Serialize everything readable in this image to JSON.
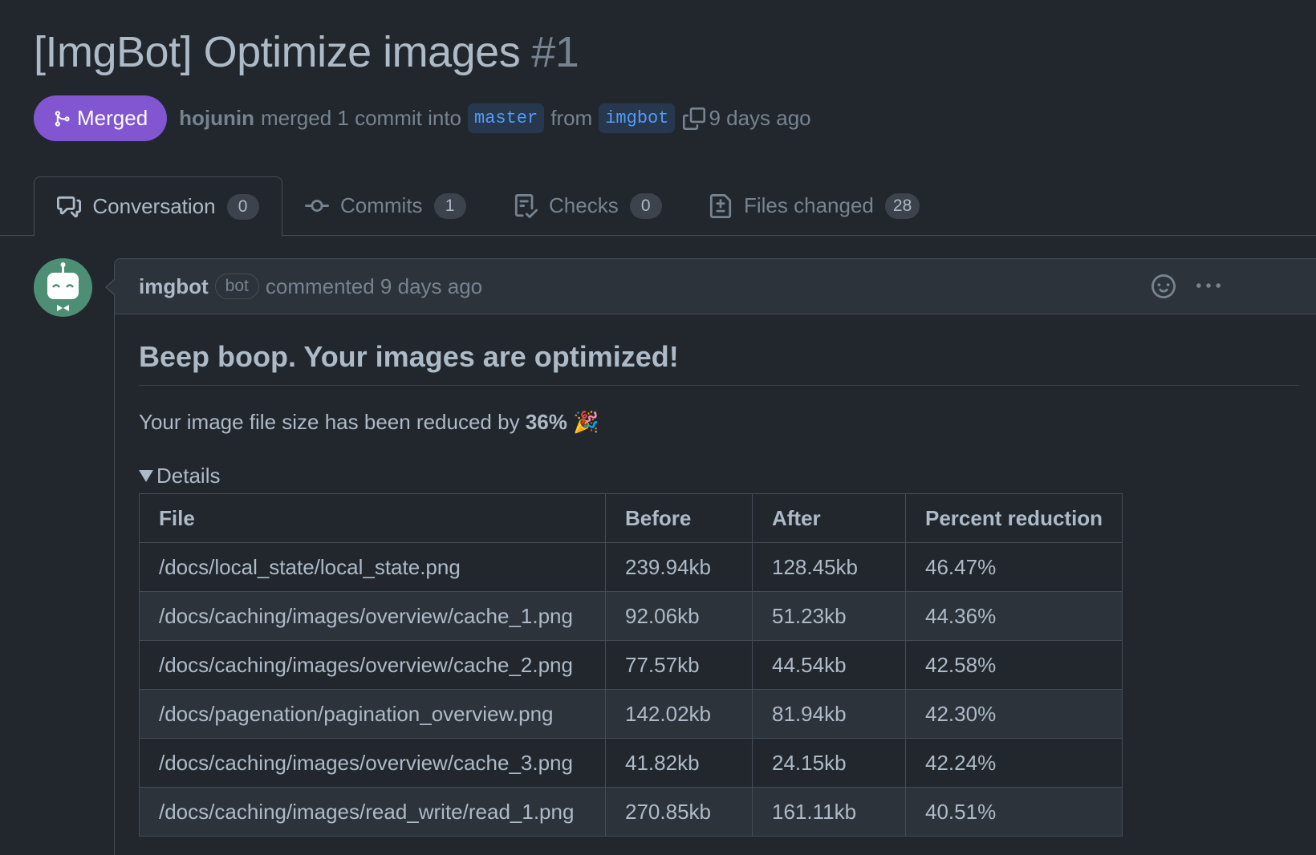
{
  "pr": {
    "title": "[ImgBot] Optimize images",
    "number": "#1",
    "state": "Merged",
    "author": "hojunin",
    "merged_text": "merged 1 commit into",
    "base_branch": "master",
    "from_text": "from",
    "head_branch": "imgbot",
    "time": "9 days ago"
  },
  "tabs": [
    {
      "label": "Conversation",
      "count": "0",
      "icon": "comment-discussion-icon"
    },
    {
      "label": "Commits",
      "count": "1",
      "icon": "git-commit-icon"
    },
    {
      "label": "Checks",
      "count": "0",
      "icon": "checklist-icon"
    },
    {
      "label": "Files changed",
      "count": "28",
      "icon": "file-diff-icon"
    }
  ],
  "comment": {
    "author": "imgbot",
    "badge": "bot",
    "meta": "commented 9 days ago",
    "heading": "Beep boop. Your images are optimized!",
    "summary_prefix": "Your image file size has been reduced by",
    "summary_percent": "36%",
    "summary_emoji": "🎉",
    "details_label": "Details"
  },
  "table": {
    "headers": [
      "File",
      "Before",
      "After",
      "Percent reduction"
    ],
    "rows": [
      [
        "/docs/local_state/local_state.png",
        "239.94kb",
        "128.45kb",
        "46.47%"
      ],
      [
        "/docs/caching/images/overview/cache_1.png",
        "92.06kb",
        "51.23kb",
        "44.36%"
      ],
      [
        "/docs/caching/images/overview/cache_2.png",
        "77.57kb",
        "44.54kb",
        "42.58%"
      ],
      [
        "/docs/pagenation/pagination_overview.png",
        "142.02kb",
        "81.94kb",
        "42.30%"
      ],
      [
        "/docs/caching/images/overview/cache_3.png",
        "41.82kb",
        "24.15kb",
        "42.24%"
      ],
      [
        "/docs/caching/images/read_write/read_1.png",
        "270.85kb",
        "161.11kb",
        "40.51%"
      ]
    ]
  },
  "colors": {
    "background": "#22272e",
    "merged": "#8256d0",
    "link": "#539bf5",
    "avatar": "#4d8f75"
  }
}
